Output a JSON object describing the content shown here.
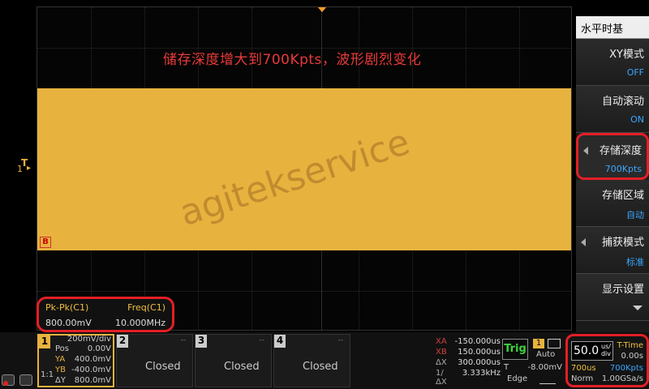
{
  "display": {
    "annotation": "储存深度增大到700Kpts，波形剧烈变化",
    "watermark": "agitekservice",
    "ref_marker": "B",
    "trigger_level": {
      "label": "T",
      "channel": "1"
    }
  },
  "measurement": {
    "items": [
      {
        "label": "Pk-Pk(C1)",
        "value": "800.00mV"
      },
      {
        "label": "Freq(C1)",
        "value": "10.000MHz"
      }
    ]
  },
  "menu": {
    "title": "水平时基",
    "items": [
      {
        "label": "XY模式",
        "value": "OFF"
      },
      {
        "label": "自动滚动",
        "value": "ON"
      },
      {
        "label": "存储深度",
        "value": "700Kpts"
      },
      {
        "label": "存储区域",
        "value": "自动"
      },
      {
        "label": "捕获模式",
        "value": "标准"
      },
      {
        "label": "显示设置",
        "value": ""
      }
    ]
  },
  "channels": {
    "ch1": {
      "num": "1",
      "scale": "200mV/div",
      "pos_label": "Pos",
      "pos_value": "0.00V",
      "ya_label": "YA",
      "ya_value": "400.0mV",
      "yb_label": "YB",
      "yb_value": "-400.0mV",
      "dy_label": "ΔY",
      "dy_value": "800.0mV",
      "coupling": "1:1"
    },
    "ch2": {
      "num": "2",
      "status": "Closed",
      "dash": "--"
    },
    "ch3": {
      "num": "3",
      "status": "Closed",
      "dash": "--"
    },
    "ch4": {
      "num": "4",
      "status": "Closed",
      "dash": "--"
    }
  },
  "cursors": {
    "xa_label": "XA",
    "xa_value": "-150.000us",
    "xb_label": "XB",
    "xb_value": "150.000us",
    "dx_label": "ΔX",
    "dx_value": "300.000us",
    "inv_label": "1/ΔX",
    "inv_value": "3.333kHz"
  },
  "trigger": {
    "button": "Trig",
    "source": "1",
    "mode": "Auto",
    "t_label": "T",
    "level": "-8.00mV",
    "type": "Edge"
  },
  "timebase": {
    "value": "50.0",
    "unit_top": "us/",
    "unit_bottom": "div",
    "t_time_label": "T-Time",
    "t_offset": "0.00s",
    "position": "700us",
    "depth": "700Kpts",
    "acq_mode": "Norm",
    "sample_rate": "1.00GSa/s"
  },
  "colors": {
    "waveform": "#e8b23e",
    "highlight": "#e31f26",
    "menu_value": "#3aa6ff",
    "annotation": "#e83a3a"
  }
}
